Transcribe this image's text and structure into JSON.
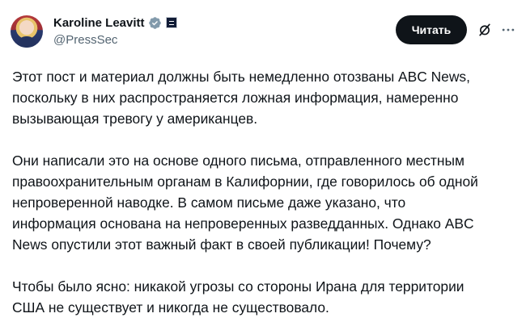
{
  "author": {
    "name": "Karoline Leavitt",
    "handle": "@PressSec"
  },
  "actions": {
    "follow_label": "Читать"
  },
  "icons": {
    "verified": "verified-badge-icon",
    "affiliation": "affiliation-badge-icon",
    "grok": "grok-icon",
    "more": "more-icon"
  },
  "colors": {
    "text": "#0f1419",
    "secondary": "#536471",
    "button_bg": "#0f1419",
    "verified": "#829aab"
  },
  "tweet": {
    "paragraphs": [
      [
        "Этот пост и материал должны быть немедленно отозваны ABC News,",
        "поскольку в них распространяется ложная информация, намеренно",
        "вызывающая тревогу у американцев."
      ],
      [
        "Они написали это на основе одного письма, отправленного местным",
        "правоохранительным органам в Калифорнии, где говорилось об одной",
        "непроверенной наводке. В самом письме даже указано, что",
        "информация основана на непроверенных разведданных. Однако ABC",
        "News опустили этот важный факт в своей публикации! Почему?"
      ],
      [
        "Чтобы было ясно: никакой угрозы со стороны Ирана для территории",
        "США не существует и никогда не существовало."
      ]
    ]
  }
}
